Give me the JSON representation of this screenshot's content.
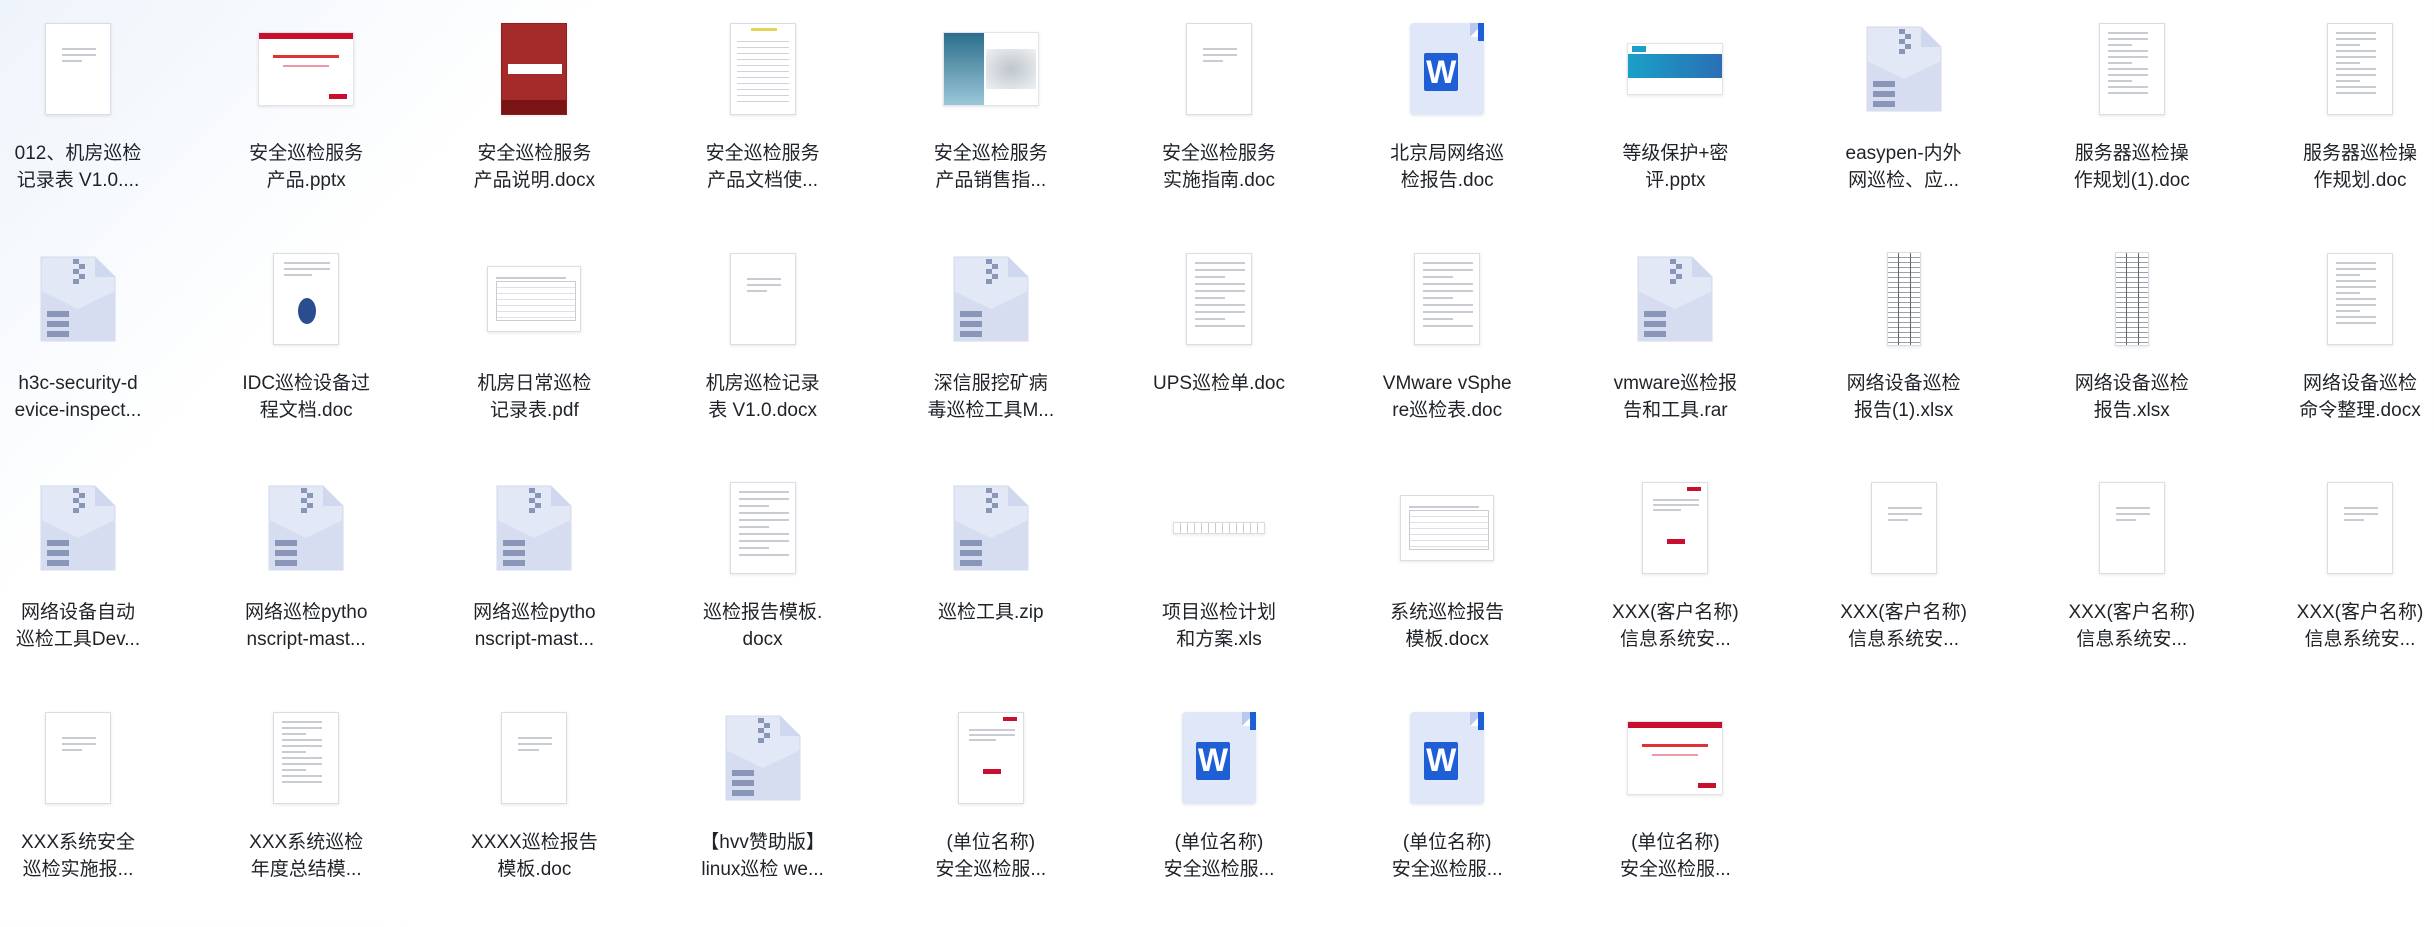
{
  "files": [
    {
      "line1": "012、机房巡检",
      "line2": "记录表 V1.0....",
      "thumb": "doc-page"
    },
    {
      "line1": "安全巡检服务",
      "line2": "产品.pptx",
      "thumb": "slide-red"
    },
    {
      "line1": "安全巡检服务",
      "line2": "产品说明.docx",
      "thumb": "doc-red-cover"
    },
    {
      "line1": "安全巡检服务",
      "line2": "产品文档使...",
      "thumb": "doc-table"
    },
    {
      "line1": "安全巡检服务",
      "line2": "产品销售指...",
      "thumb": "slide-map"
    },
    {
      "line1": "安全巡检服务",
      "line2": "实施指南.doc",
      "thumb": "doc-page"
    },
    {
      "line1": "北京局网络巡",
      "line2": "检报告.doc",
      "thumb": "word-icon"
    },
    {
      "line1": "等级保护+密",
      "line2": "评.pptx",
      "thumb": "slide-blue"
    },
    {
      "line1": "easypen-内外",
      "line2": "网巡检、应...",
      "thumb": "zip-icon"
    },
    {
      "line1": "服务器巡检操",
      "line2": "作规划(1).doc",
      "thumb": "doc-text"
    },
    {
      "line1": "服务器巡检操",
      "line2": "作规划.doc",
      "thumb": "doc-text"
    },
    {
      "line1": "h3c-security-d",
      "line2": "evice-inspect...",
      "thumb": "zip-icon"
    },
    {
      "line1": "IDC巡检设备过",
      "line2": "程文档.doc",
      "thumb": "doc-emblem"
    },
    {
      "line1": "机房日常巡检",
      "line2": "记录表.pdf",
      "thumb": "doc-landscape"
    },
    {
      "line1": "机房巡检记录",
      "line2": "表 V1.0.docx",
      "thumb": "doc-page"
    },
    {
      "line1": "深信服挖矿病",
      "line2": "毒巡检工具M...",
      "thumb": "zip-icon"
    },
    {
      "line1": "UPS巡检单.doc",
      "line2": "",
      "thumb": "doc-form"
    },
    {
      "line1": "VMware vSphe",
      "line2": "re巡检表.doc",
      "thumb": "doc-form"
    },
    {
      "line1": "vmware巡检报",
      "line2": "告和工具.rar",
      "thumb": "zip-icon"
    },
    {
      "line1": "网络设备巡检",
      "line2": "报告(1).xlsx",
      "thumb": "sheet-tall"
    },
    {
      "line1": "网络设备巡检",
      "line2": "报告.xlsx",
      "thumb": "sheet-tall"
    },
    {
      "line1": "网络设备巡检",
      "line2": "命令整理.docx",
      "thumb": "doc-text"
    },
    {
      "line1": "网络设备自动",
      "line2": "巡检工具Dev...",
      "thumb": "zip-icon"
    },
    {
      "line1": "网络巡检pytho",
      "line2": "nscript-mast...",
      "thumb": "zip-icon"
    },
    {
      "line1": "网络巡检pytho",
      "line2": "nscript-mast...",
      "thumb": "zip-icon"
    },
    {
      "line1": "巡检报告模板.",
      "line2": "docx",
      "thumb": "doc-form"
    },
    {
      "line1": "巡检工具.zip",
      "line2": "",
      "thumb": "zip-icon"
    },
    {
      "line1": "项目巡检计划",
      "line2": "和方案.xls",
      "thumb": "sheet-flat"
    },
    {
      "line1": "系统巡检报告",
      "line2": "模板.docx",
      "thumb": "doc-landscape"
    },
    {
      "line1": "XXX(客户名称)",
      "line2": "信息系统安...",
      "thumb": "doc-red-logo"
    },
    {
      "line1": "XXX(客户名称)",
      "line2": "信息系统安...",
      "thumb": "doc-page"
    },
    {
      "line1": "XXX(客户名称)",
      "line2": "信息系统安...",
      "thumb": "doc-page"
    },
    {
      "line1": "XXX(客户名称)",
      "line2": "信息系统安...",
      "thumb": "doc-page"
    },
    {
      "line1": "XXX系统安全",
      "line2": "巡检实施报...",
      "thumb": "doc-page"
    },
    {
      "line1": "XXX系统巡检",
      "line2": "年度总结模...",
      "thumb": "doc-text"
    },
    {
      "line1": "XXXX巡检报告",
      "line2": "模板.doc",
      "thumb": "doc-page"
    },
    {
      "line1": "【hvv赞助版】",
      "line2": "linux巡检 we...",
      "thumb": "zip-icon"
    },
    {
      "line1": "(单位名称)",
      "line2": "安全巡检服...",
      "thumb": "doc-red-logo"
    },
    {
      "line1": "(单位名称)",
      "line2": "安全巡检服...",
      "thumb": "word-icon"
    },
    {
      "line1": "(单位名称)",
      "line2": "安全巡检服...",
      "thumb": "word-icon"
    },
    {
      "line1": "(单位名称)",
      "line2": "安全巡检服...",
      "thumb": "slide-red"
    }
  ]
}
